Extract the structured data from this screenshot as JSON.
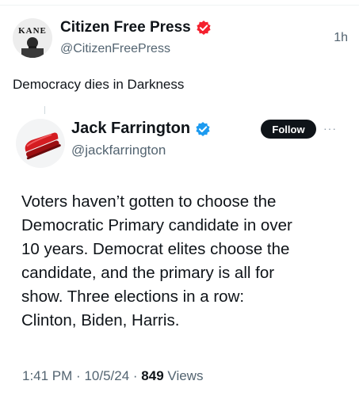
{
  "outer_post": {
    "avatar_text": "KANE",
    "display_name": "Citizen Free Press",
    "handle": "@CitizenFreePress",
    "time": "1h",
    "badge_color": "#f4212e",
    "caption": "Democracy dies in Darkness"
  },
  "quoted_post": {
    "display_name": "Jack Farrington",
    "handle": "@jackfarrington",
    "badge_color": "#1d9bf0",
    "follow_label": "Follow",
    "more_label": "···",
    "body": "Voters haven’t gotten to choose the\nDemocratic Primary candidate in over\n10 years. Democrat elites choose the\ncandidate, and the primary is all for\nshow. Three elections in a row:\nClinton, Biden, Harris.",
    "time": "1:41 PM",
    "date": "10/5/24",
    "views_count": "849",
    "views_label": "Views"
  },
  "icons": {
    "outer_badge": "verified-badge-icon",
    "inner_badge": "verified-badge-icon",
    "inner_avatar": "red-stapler-icon",
    "more": "more-options-icon"
  }
}
